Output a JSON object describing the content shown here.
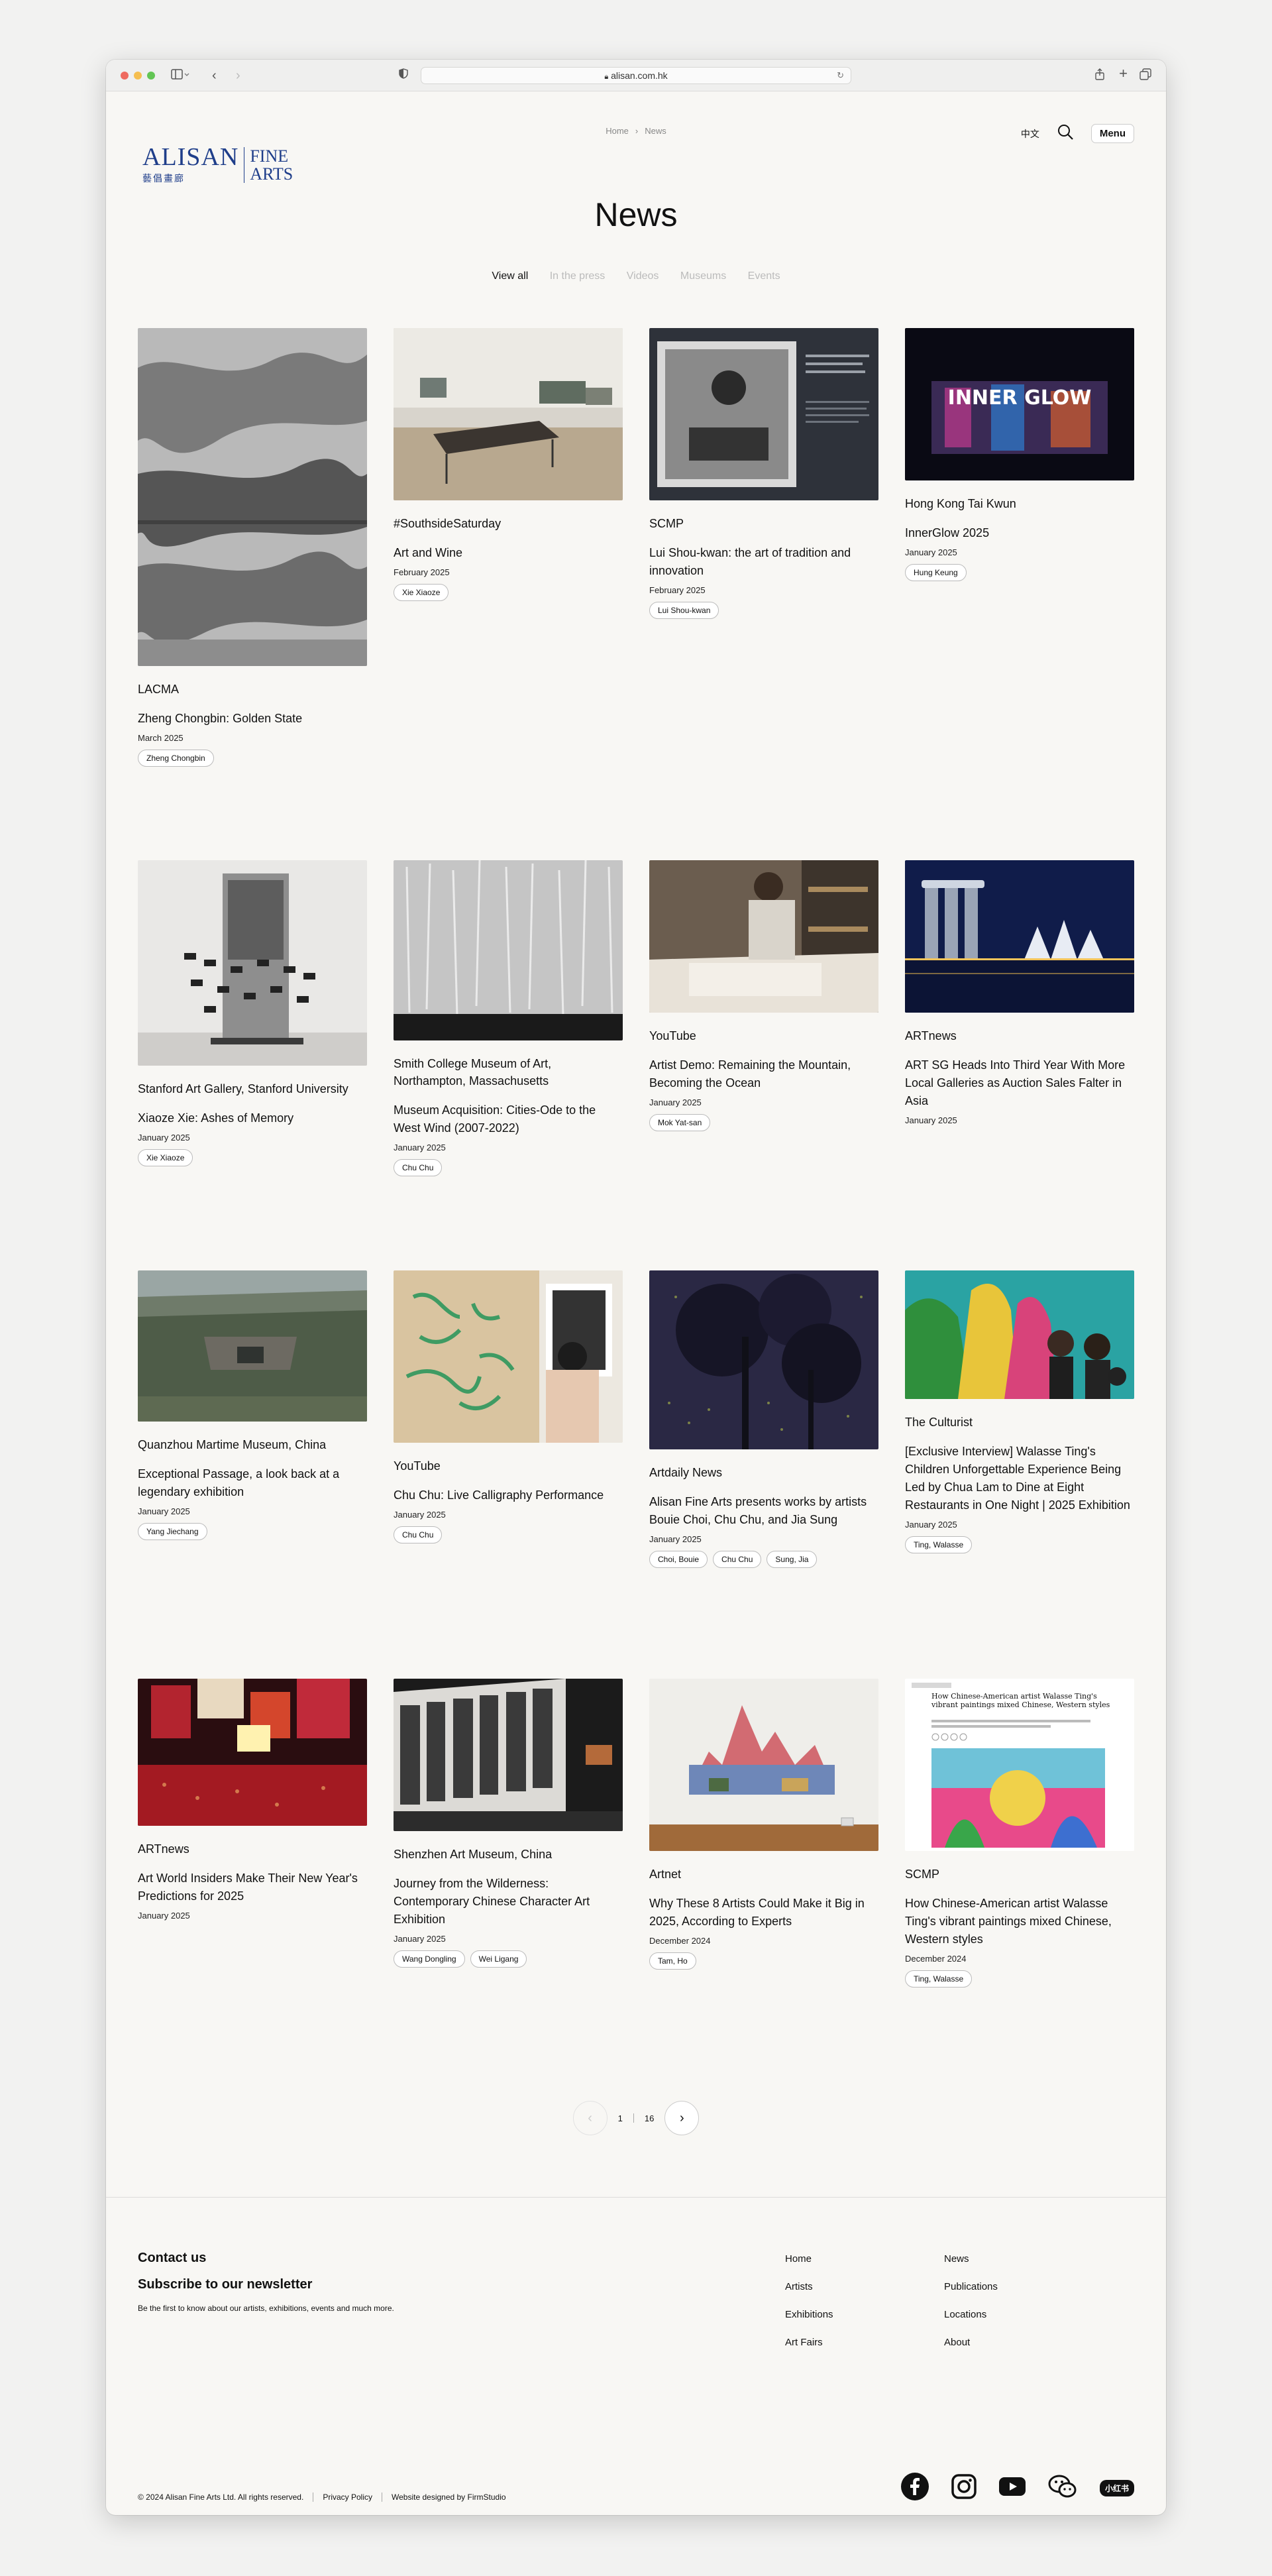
{
  "browser": {
    "url": "alisan.com.hk"
  },
  "logo": {
    "main": "ALISAN",
    "chinese": "藝倡畫廊",
    "fine": "FINE",
    "arts": "ARTS"
  },
  "breadcrumb": {
    "home": "Home",
    "current": "News"
  },
  "header": {
    "lang": "中文",
    "menu": "Menu"
  },
  "page": {
    "title": "News"
  },
  "filters": [
    "View all",
    "In the press",
    "Videos",
    "Museums",
    "Events"
  ],
  "cards": [
    {
      "source": "LACMA",
      "title": "Zheng Chongbin: Golden State",
      "date": "March 2025",
      "tags": [
        "Zheng Chongbin"
      ]
    },
    {
      "source": "#SouthsideSaturday",
      "title": "Art and Wine",
      "date": "February 2025",
      "tags": [
        "Xie Xiaoze"
      ]
    },
    {
      "source": "SCMP",
      "title": "Lui Shou-kwan: the art of tradition and innovation",
      "date": "February 2025",
      "tags": [
        "Lui Shou-kwan"
      ]
    },
    {
      "source": "Hong Kong Tai Kwun",
      "title": "InnerGlow 2025",
      "date": "January 2025",
      "tags": [
        "Hung Keung"
      ],
      "thumb_text": "INNER GLOW"
    },
    {
      "source": "Stanford Art Gallery, Stanford University",
      "title": "Xiaoze Xie: Ashes of Memory",
      "date": "January 2025",
      "tags": [
        "Xie Xiaoze"
      ]
    },
    {
      "source": "Smith College Museum of Art, Northampton, Massachusetts",
      "title": "Museum Acquisition: Cities-Ode to the West Wind (2007-2022)",
      "date": "January 2025",
      "tags": [
        "Chu Chu"
      ]
    },
    {
      "source": "YouTube",
      "title": "Artist Demo: Remaining the Mountain, Becoming the Ocean",
      "date": "January 2025",
      "tags": [
        "Mok Yat-san"
      ]
    },
    {
      "source": "ARTnews",
      "title": "ART SG Heads Into Third Year With More Local Galleries as Auction Sales Falter in Asia",
      "date": "January 2025",
      "tags": []
    },
    {
      "source": "Quanzhou Martime Museum, China",
      "title": "Exceptional Passage, a look back at a legendary exhibition",
      "date": "January 2025",
      "tags": [
        "Yang Jiechang"
      ]
    },
    {
      "source": "YouTube",
      "title": "Chu Chu: Live Calligraphy Performance",
      "date": "January 2025",
      "tags": [
        "Chu Chu"
      ]
    },
    {
      "source": "Artdaily News",
      "title": "Alisan Fine Arts presents works by artists Bouie Choi, Chu Chu, and Jia Sung",
      "date": "January 2025",
      "tags": [
        "Choi, Bouie",
        "Chu Chu",
        "Sung, Jia"
      ]
    },
    {
      "source": "The Culturist",
      "title": "[Exclusive Interview] Walasse Ting's Children Unforgettable Experience Being Led by Chua Lam to Dine at Eight Restaurants in One Night | 2025 Exhibition",
      "date": "January 2025",
      "tags": [
        "Ting, Walasse"
      ]
    },
    {
      "source": "ARTnews",
      "title": "Art World Insiders Make Their New Year's Predictions for 2025",
      "date": "January 2025",
      "tags": []
    },
    {
      "source": "Shenzhen Art Museum, China",
      "title": "Journey from the Wilderness: Contemporary Chinese Character Art Exhibition",
      "date": "January 2025",
      "tags": [
        "Wang Dongling",
        "Wei Ligang"
      ]
    },
    {
      "source": "Artnet",
      "title": "Why These 8 Artists Could Make it Big in 2025, According to Experts",
      "date": "December 2024",
      "tags": [
        "Tam, Ho"
      ]
    },
    {
      "source": "SCMP",
      "title": "How Chinese-American artist Walasse Ting's vibrant paintings mixed Chinese, Western styles",
      "date": "December 2024",
      "tags": [
        "Ting, Walasse"
      ],
      "thumb_text": "How Chinese-American artist Walasse Ting's vibrant paintings mixed Chinese, Western styles"
    }
  ],
  "pagination": {
    "current": "1",
    "total": "16"
  },
  "footer": {
    "contact": "Contact us",
    "subscribe": "Subscribe to our newsletter",
    "subscribe_text": "Be the first to know about our artists, exhibitions, events and much more.",
    "nav_col1": [
      "Home",
      "Artists",
      "Exhibitions",
      "Art Fairs"
    ],
    "nav_col2": [
      "News",
      "Publications",
      "Locations",
      "About"
    ],
    "copyright": "© 2024 Alisan Fine Arts Ltd. All rights reserved.",
    "privacy": "Privacy Policy",
    "credit": "Website designed by FirmStudio",
    "socials": [
      "facebook-icon",
      "instagram-icon",
      "youtube-icon",
      "wechat-icon",
      "xiaohongshu-icon"
    ],
    "xhs_label": "小红书"
  }
}
